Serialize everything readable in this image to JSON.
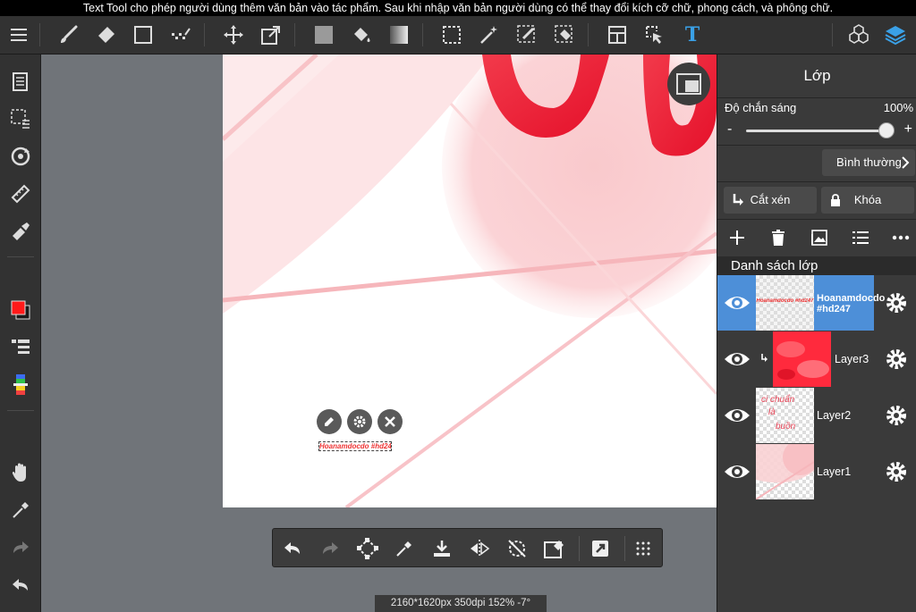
{
  "tip": "Text Tool cho phép người dùng thêm văn bản vào tác phẩm. Sau khi nhập văn bản người dùng có thể thay đổi kích cỡ chữ, phong cách, và phông chữ.",
  "toolbar": {
    "icons": [
      "menu-icon",
      "brush-icon",
      "eraser-icon",
      "shape-icon",
      "dot-brush-icon",
      "move-icon",
      "transform-icon",
      "fill-color-icon",
      "bucket-icon",
      "gradient-icon",
      "select-rect-icon",
      "magic-wand-icon",
      "select-pen-icon",
      "select-eraser-icon",
      "frame-icon",
      "operation-icon",
      "text-tool-icon",
      "3d-icon",
      "layers-icon"
    ],
    "text_tool_glyph": "T",
    "accent": "#3aa0e6"
  },
  "leftbar": {
    "icons": [
      "pages-icon",
      "selection-icon",
      "rotate-icon",
      "ruler-icon",
      "fill-tool-icon",
      "color-swatch-icon",
      "brush-list-icon",
      "color-palette-icon",
      "hand-icon",
      "eyedropper-icon",
      "redo-icon",
      "undo-icon"
    ],
    "primary_color": "#ff1a1a",
    "secondary_color": "#1a1a1a"
  },
  "canvas": {
    "text_object": "Hoanamdocdo #hd247"
  },
  "bottom_tools": {
    "icons": [
      "undo-icon",
      "redo-icon",
      "transform-icon",
      "eyedropper-icon",
      "save-icon",
      "flip-icon",
      "rotate-reset-icon",
      "clear-icon",
      "snap-icon",
      "more-grid-icon"
    ]
  },
  "status": "2160*1620px 350dpi 152% -7°",
  "panel": {
    "title": "Lớp",
    "opacity_label": "Độ chắn sáng",
    "opacity_value": "100%",
    "opacity": 1.0,
    "minus": "-",
    "plus": "+",
    "blend_mode": "Bình thường",
    "clip_label": "Cắt xén",
    "lock_label": "Khóa",
    "list_title": "Danh sách lớp",
    "layers": [
      {
        "name": "Hoanamdocdo #hd247",
        "active": true
      },
      {
        "name": "Layer3",
        "clipped": true
      },
      {
        "name": "Layer2"
      },
      {
        "name": "Layer1"
      }
    ],
    "layer1_thumb_text": "Hoanamdocdo #hd247",
    "layer2_thumb_text": [
      "ci chuẩn",
      "là",
      "buồn"
    ],
    "active_color": "#4d8fd8"
  }
}
